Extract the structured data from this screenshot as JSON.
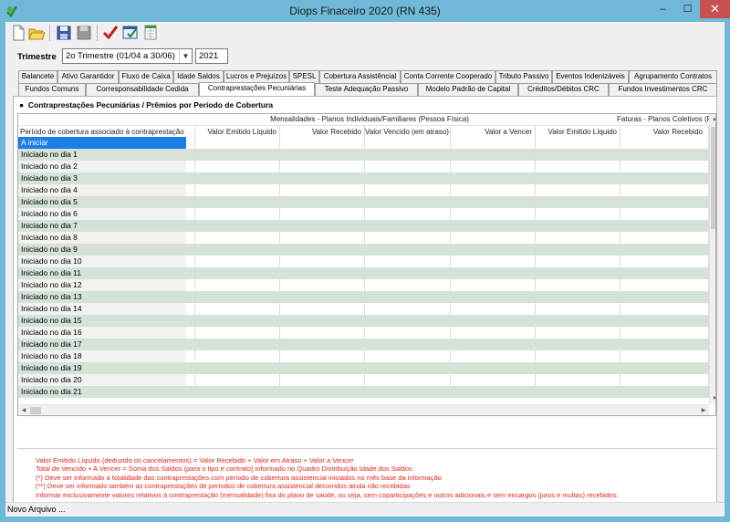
{
  "window": {
    "title": "Diops Finaceiro 2020 (RN 435)",
    "min": "–",
    "max": "☐",
    "close": "✕"
  },
  "toolbar": {
    "buttons": [
      "new-file-icon",
      "open-folder-icon",
      "save-icon",
      "save-disabled-icon",
      "check-icon",
      "validate-window-icon",
      "export-sheet-icon"
    ]
  },
  "period": {
    "label": "Trimestre",
    "selected": "2o Trimestre (01/04 a 30/06)",
    "year": "2021"
  },
  "tabs_row1": [
    "Balancete",
    "Ativo Garantidor",
    "Fluxo de Caixa",
    "Idade Saldos",
    "Lucros e Prejuízos",
    "SPESL",
    "Cobertura Assistêncial",
    "Conta Corrente Cooperado",
    "Tributo Passivo",
    "Eventos Indenizáveis",
    "Agrupamento Contratos"
  ],
  "tabs_row2": [
    "Fundos Comuns",
    "Corresponsabilidade Cedida",
    "Contraprestações Pecuniárias",
    "Teste Adequação Passivo",
    "Modelo Padrão de Capital",
    "Créditos/Débitos CRC",
    "Fundos Investimentos CRC"
  ],
  "active_tab": "Contraprestações Pecuniárias",
  "panel": {
    "title": "Contraprestações Pecuniárias / Prêmios por Período de Cobertura",
    "group_headers": [
      "Mensalidades - Planos Individuais/Familiares (Pessoa Física)",
      "Faturas - Planos Coletivos (P"
    ],
    "columns": [
      "Período de cobertura associado à contraprestação",
      "Valor Emitido Líquido",
      "Valor Recebido",
      "Valor Vencido (em atraso)",
      "Valor a Vencer",
      "Valor Emitido Líquido",
      "Valor Recebido"
    ],
    "rows": [
      "A iniciar",
      "Iniciado no dia 1",
      "Iniciado no dia 2",
      "Iniciado no dia 3",
      "Iniciado no dia 4",
      "Iniciado no dia 5",
      "Iniciado no dia 6",
      "Iniciado no dia 7",
      "Iniciado no dia 8",
      "Iniciado no dia 9",
      "Iniciado no dia 10",
      "Iniciado no dia 11",
      "Iniciado no dia 12",
      "Iniciado no dia 13",
      "Iniciado no dia 14",
      "Iniciado no dia 15",
      "Iniciado no dia 16",
      "Iniciado no dia 17",
      "Iniciado no dia 18",
      "Iniciado no dia 19",
      "Iniciado no dia 20",
      "Iniciado no dia 21"
    ],
    "notes": [
      "Valor Emitido Líquido (deduzido os cancelamentos) = Valor Recebido + Valor em Atraso + Valor a Vencer",
      "Total de Vencido + A Vencer = Soma dos Saldos (para o tipo e contrato) informado no Quadro Distribuição Idade dos Saldos",
      "(*) Deve ser informado a totalidade das contraprestações com período de cobertura assistencial iniciados no mês base da informação",
      "(**) Deve ser informado também as contraprestações de períodos de cobertura assistencial decorridos ainda não recebidas",
      "Informar exclusivamente valores relativos à contraprestação (mensalidade) fixa do plano de saúde, ou seja, sem coparticipações e outros adicionais e sem encargos (juros e multas) recebidos."
    ]
  },
  "status": {
    "text": "Novo Arquivo ..."
  },
  "colors": {
    "titlebar": "#70b8d8",
    "close": "#c75050",
    "row_alt": "#d4e2d7",
    "selected": "#1e7ee8",
    "note": "#e8231c"
  }
}
